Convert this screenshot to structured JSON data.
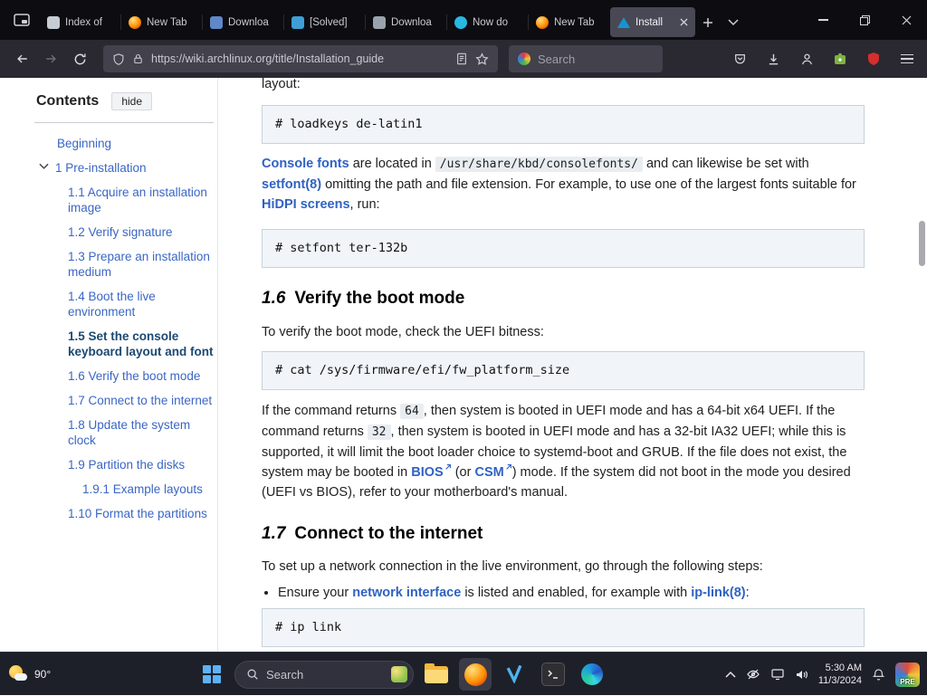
{
  "window": {
    "tabs": [
      {
        "label": "Index of"
      },
      {
        "label": "New Tab"
      },
      {
        "label": "Downloa"
      },
      {
        "label": "[Solved]"
      },
      {
        "label": "Downloa"
      },
      {
        "label": "Now do"
      },
      {
        "label": "New Tab"
      },
      {
        "label": "Install"
      }
    ]
  },
  "toolbar": {
    "url": "https://wiki.archlinux.org/title/Installation_guide",
    "search_placeholder": "Search"
  },
  "toc": {
    "title": "Contents",
    "hide": "hide",
    "items": [
      {
        "label": "Beginning"
      },
      {
        "label": "1 Pre-installation"
      },
      {
        "label": "1.1 Acquire an installation image"
      },
      {
        "label": "1.2 Verify signature"
      },
      {
        "label": "1.3 Prepare an installation medium"
      },
      {
        "label": "1.4 Boot the live environment"
      },
      {
        "label": "1.5 Set the console keyboard layout and font"
      },
      {
        "label": "1.6 Verify the boot mode"
      },
      {
        "label": "1.7 Connect to the internet"
      },
      {
        "label": "1.8 Update the system clock"
      },
      {
        "label": "1.9 Partition the disks"
      },
      {
        "label": "1.9.1 Example layouts"
      },
      {
        "label": "1.10 Format the partitions"
      }
    ]
  },
  "article": {
    "partial_top": "layout:",
    "code1": "# loadkeys de-latin1",
    "p1": {
      "link1": "Console fonts",
      "t1": " are located in ",
      "code": "/usr/share/kbd/consolefonts/",
      "t2": " and can likewise be set with ",
      "link2": "setfont(8)",
      "t3": " omitting the path and file extension. For example, to use one of the largest fonts suitable for ",
      "link3": "HiDPI screens",
      "t4": ", run:"
    },
    "code2": "# setfont ter-132b",
    "h16": {
      "num": "1.6",
      "text": "Verify the boot mode"
    },
    "p2": "To verify the boot mode, check the UEFI bitness:",
    "code3": "# cat /sys/firmware/efi/fw_platform_size",
    "p3": {
      "t1": "If the command returns ",
      "c1": "64",
      "t2": ", then system is booted in UEFI mode and has a 64-bit x64 UEFI. If the command returns ",
      "c2": "32",
      "t3": ", then system is booted in UEFI mode and has a 32-bit IA32 UEFI; while this is supported, it will limit the boot loader choice to systemd-boot and GRUB. If the file does not exist, the system may be booted in ",
      "l1": "BIOS",
      "t4": " (or ",
      "l2": "CSM",
      "t5": ") mode. If the system did not boot in the mode you desired (UEFI vs BIOS), refer to your motherboard's manual."
    },
    "h17": {
      "num": "1.7",
      "text": "Connect to the internet"
    },
    "p4": "To set up a network connection in the live environment, go through the following steps:",
    "li1": {
      "t1": "Ensure your ",
      "l1": "network interface",
      "t2": " is listed and enabled, for example with ",
      "l2": "ip-link(8)",
      "t3": ":"
    },
    "code4": "# ip link"
  },
  "taskbar": {
    "weather_temp": "90°",
    "search_placeholder": "Search",
    "clock_time": "5:30 AM",
    "clock_date": "11/3/2024",
    "preview_badge": "PRE"
  },
  "colors": {
    "link_blue": "#2f62c4",
    "arch_logo_blue": "#1793d1",
    "ublock_red": "#d32f2f"
  }
}
